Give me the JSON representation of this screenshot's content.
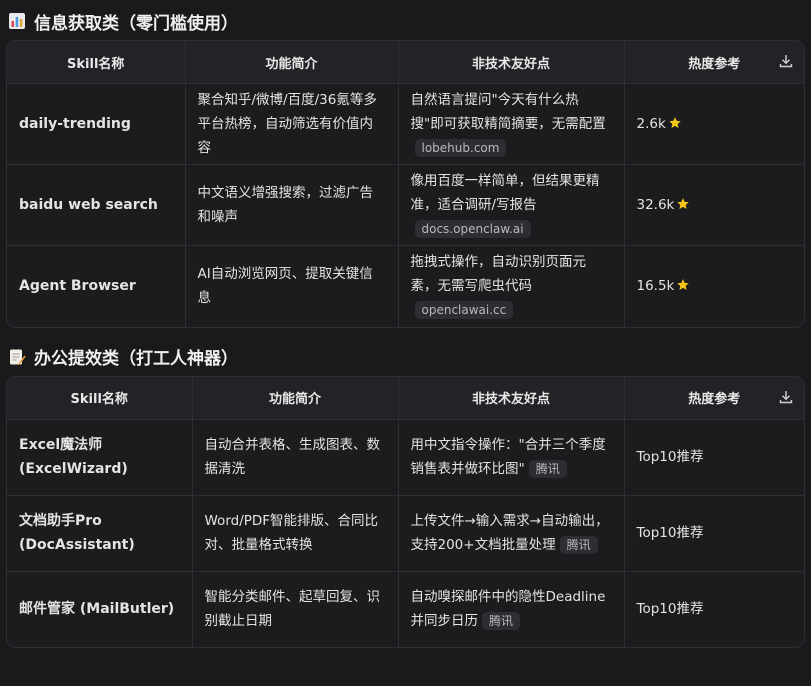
{
  "section1": {
    "title": "信息获取类（零门槛使用）",
    "headers": [
      "Skill名称",
      "功能简介",
      "非技术友好点",
      "热度参考"
    ],
    "rows": [
      {
        "name": "daily-trending",
        "desc": "聚合知乎/微博/百度/36氪等多平台热榜，自动筛选有价值内容",
        "friendly": "自然语言提问\"今天有什么热搜\"即可获取精简摘要，无需配置",
        "tag": "lobehub.com",
        "heat": "2.6k"
      },
      {
        "name": "baidu web search",
        "desc": "中文语义增强搜索，过滤广告和噪声",
        "friendly": "像用百度一样简单，但结果更精准，适合调研/写报告",
        "tag": "docs.openclaw.ai",
        "heat": "32.6k"
      },
      {
        "name": "Agent Browser",
        "desc": "AI自动浏览网页、提取关键信息",
        "friendly": "拖拽式操作，自动识别页面元素，无需写爬虫代码",
        "tag": "openclawai.cc",
        "heat": "16.5k"
      }
    ]
  },
  "section2": {
    "title": "办公提效类（打工人神器）",
    "headers": [
      "Skill名称",
      "功能简介",
      "非技术友好点",
      "热度参考"
    ],
    "rows": [
      {
        "name_line1": "Excel魔法师",
        "name_line2": "(ExcelWizard)",
        "desc": "自动合并表格、生成图表、数据清洗",
        "friendly": "用中文指令操作：\"合并三个季度销售表并做环比图\"",
        "tag": "腾讯",
        "heat": "Top10推荐"
      },
      {
        "name_line1": "文档助手Pro",
        "name_line2": "(DocAssistant)",
        "desc": "Word/PDF智能排版、合同比对、批量格式转换",
        "friendly": "上传文件→输入需求→自动输出，支持200+文档批量处理",
        "tag": "腾讯",
        "heat": "Top10推荐"
      },
      {
        "name_line1": "邮件管家 (MailButler)",
        "name_line2": "",
        "desc": "智能分类邮件、起草回复、识别截止日期",
        "friendly": "自动嗅探邮件中的隐性Deadline并同步日历",
        "tag": "腾讯",
        "heat": "Top10推荐"
      }
    ]
  },
  "icons": {
    "section1": "bar-chart-icon",
    "section2": "memo-icon",
    "star": "star-icon",
    "download": "download-icon"
  },
  "colors": {
    "star": "#f5c518",
    "background": "#1a1a1d"
  }
}
